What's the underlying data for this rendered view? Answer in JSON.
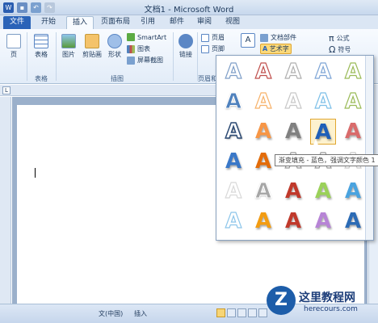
{
  "window": {
    "title": "文档1 - Microsoft Word"
  },
  "tabs": [
    "文件",
    "开始",
    "插入",
    "页面布局",
    "引用",
    "邮件",
    "审阅",
    "视图"
  ],
  "ribbon": {
    "page_btn": "页",
    "table_btn": "表格",
    "picture_btn": "图片",
    "clipart_btn": "剪贴画",
    "shapes_btn": "形状",
    "smartart": "SmartArt",
    "chart": "图表",
    "screenshot": "屏幕截图",
    "link_btn": "链接",
    "header": "页眉",
    "footer": "页脚",
    "docparts": "文档部件",
    "wordart": "艺术字",
    "equation": "公式",
    "symbol": "符号",
    "group_table": "表格",
    "group_illustrations": "插图",
    "group_header_footer": "页眉和"
  },
  "wordart_gallery": {
    "items": [
      {
        "glyph": "A",
        "color": "#7f9fc8",
        "style": "outline"
      },
      {
        "glyph": "A",
        "color": "#c0504d",
        "style": "outline"
      },
      {
        "glyph": "A",
        "color": "#b0b0b0",
        "style": "outline"
      },
      {
        "glyph": "A",
        "color": "#7fa6d6",
        "style": "outline"
      },
      {
        "glyph": "A",
        "color": "#9bbb59",
        "style": "outline"
      },
      {
        "glyph": "A",
        "color": "#4f81bd",
        "style": "gradient"
      },
      {
        "glyph": "A",
        "color": "#f7b26a",
        "style": "outline"
      },
      {
        "glyph": "A",
        "color": "#c8c8c8",
        "style": "outline"
      },
      {
        "glyph": "A",
        "color": "#7ec0e8",
        "style": "outline"
      },
      {
        "glyph": "A",
        "color": "#9bbb59",
        "style": "outline"
      },
      {
        "glyph": "A",
        "color": "#2c4a74",
        "style": "shadow"
      },
      {
        "glyph": "A",
        "color": "#f79646",
        "style": "solid"
      },
      {
        "glyph": "A",
        "color": "#808080",
        "style": "solid"
      },
      {
        "glyph": "A",
        "color": "#1f5fb8",
        "style": "solid"
      },
      {
        "glyph": "A",
        "color": "#d96b6b",
        "style": "solid"
      },
      {
        "glyph": "A",
        "color": "#3a78c8",
        "style": "solid"
      },
      {
        "glyph": "A",
        "color": "#e36c09",
        "style": "solid"
      },
      {
        "glyph": "A",
        "color": "#ffffff",
        "style": "outline"
      },
      {
        "glyph": "A",
        "color": "#ffffff",
        "style": "outline"
      },
      {
        "glyph": "A",
        "color": "#c8c8c8",
        "style": "outline"
      },
      {
        "glyph": "A",
        "color": "#d9d9d9",
        "style": "outline"
      },
      {
        "glyph": "A",
        "color": "#a6a6a6",
        "style": "gradient"
      },
      {
        "glyph": "A",
        "color": "#c0392b",
        "style": "solid"
      },
      {
        "glyph": "A",
        "color": "#9bd15a",
        "style": "solid"
      },
      {
        "glyph": "A",
        "color": "#4aa3df",
        "style": "solid"
      },
      {
        "glyph": "A",
        "color": "#8ec6ea",
        "style": "outline"
      },
      {
        "glyph": "A",
        "color": "#f39c12",
        "style": "solid"
      },
      {
        "glyph": "A",
        "color": "#c0392b",
        "style": "solid"
      },
      {
        "glyph": "A",
        "color": "#b784d6",
        "style": "solid"
      },
      {
        "glyph": "A",
        "color": "#2c6bb5",
        "style": "solid"
      }
    ],
    "selected_index": 13,
    "tooltip": "渐变填充 - 蓝色，强调文字颜色 1"
  },
  "status": {
    "language": "文(中国)",
    "mode": "插入"
  },
  "watermark": {
    "logo": "Z",
    "title": "这里教程网",
    "url": "herecours.com"
  }
}
